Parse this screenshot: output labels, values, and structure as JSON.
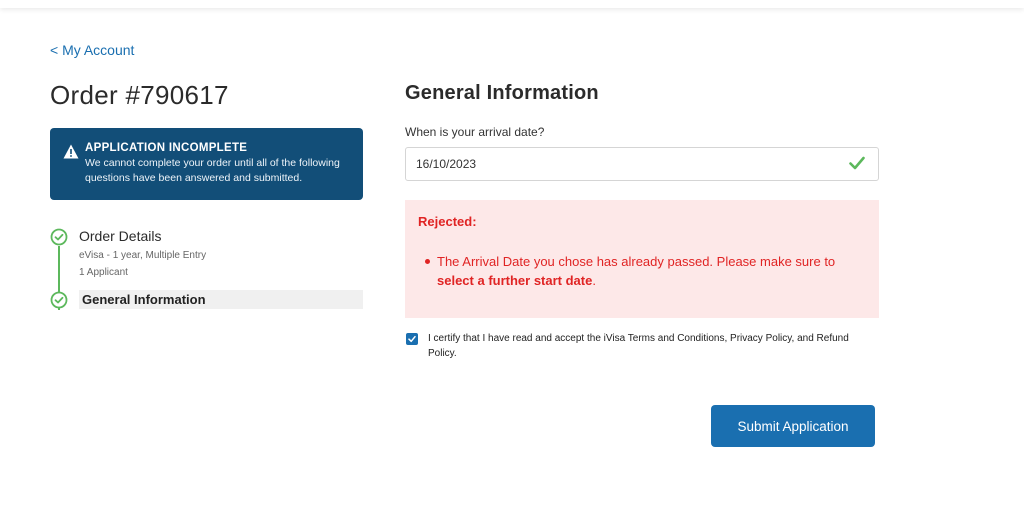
{
  "nav": {
    "back_label": "< My Account"
  },
  "order": {
    "title": "Order #790617"
  },
  "alert": {
    "icon": "warning-icon",
    "title": "APPLICATION INCOMPLETE",
    "text": "We cannot complete your order until all of the following questions have been answered and submitted."
  },
  "steps": [
    {
      "title": "Order Details",
      "details": [
        "eVisa - 1 year, Multiple Entry",
        "1 Applicant"
      ],
      "icon": "check-circle-icon"
    },
    {
      "title": "General Information",
      "icon": "check-circle-icon"
    }
  ],
  "form": {
    "section_title": "General Information",
    "arrival_label": "When is your arrival date?",
    "arrival_value": "16/10/2023"
  },
  "rejection": {
    "title": "Rejected:",
    "message_prefix": "The Arrival Date you chose has already passed. Please make sure to ",
    "message_bold": "select a further start date",
    "message_suffix": "."
  },
  "certify": {
    "checked": true,
    "text": "I certify that I have read and accept the iVisa Terms and Conditions, Privacy Policy, and Refund Policy."
  },
  "submit": {
    "label": "Submit Application"
  },
  "colors": {
    "accent": "#1a6fb0",
    "alert_bg": "#124e78",
    "success": "#5cb85c",
    "error": "#e02424",
    "error_bg": "#fde8e8"
  }
}
